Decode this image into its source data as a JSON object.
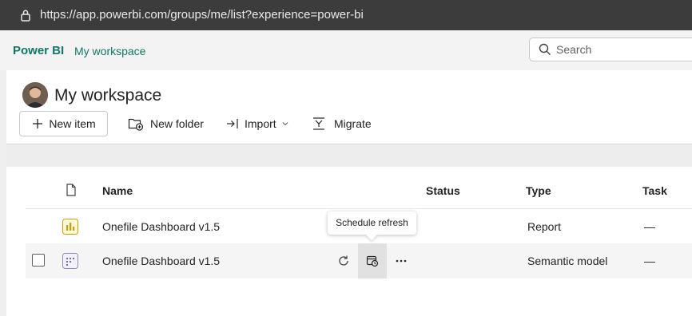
{
  "browser": {
    "url": "https://app.powerbi.com/groups/me/list?experience=power-bi"
  },
  "topbar": {
    "brand": "Power BI",
    "breadcrumb": "My workspace",
    "search_placeholder": "Search"
  },
  "workspace": {
    "title": "My workspace"
  },
  "toolbar": {
    "new_item": "New item",
    "new_folder": "New folder",
    "import": "Import",
    "migrate": "Migrate"
  },
  "table": {
    "headers": {
      "name": "Name",
      "status": "Status",
      "type": "Type",
      "task": "Task"
    },
    "rows": [
      {
        "name": "Onefile Dashboard v1.5",
        "type": "Report",
        "task": "—"
      },
      {
        "name": "Onefile Dashboard v1.5",
        "type": "Semantic model",
        "task": "—"
      }
    ]
  },
  "tooltip": "Schedule refresh",
  "colors": {
    "accent": "#117865",
    "report_icon": "#c8a000",
    "semantic_icon": "#5b5fc7"
  }
}
